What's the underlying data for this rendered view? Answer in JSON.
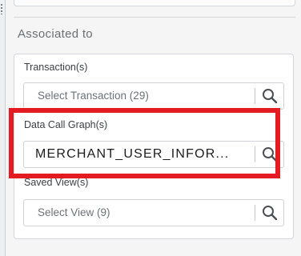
{
  "panel": {
    "section_title": "Associated to"
  },
  "fields": {
    "transaction": {
      "label": "Transaction(s)",
      "placeholder": "Select Transaction (29)"
    },
    "data_call_graph": {
      "label": "Data Call Graph(s)",
      "value": "MERCHANT_USER_INFOR..."
    },
    "saved_view": {
      "label": "Saved View(s)",
      "placeholder": "Select View (9)"
    }
  },
  "icons": {
    "search": "search-icon",
    "grip": "drag-handle-icon"
  },
  "colors": {
    "highlight": "#e41b23",
    "border": "#d3d6da",
    "background": "#f5f5f6"
  }
}
